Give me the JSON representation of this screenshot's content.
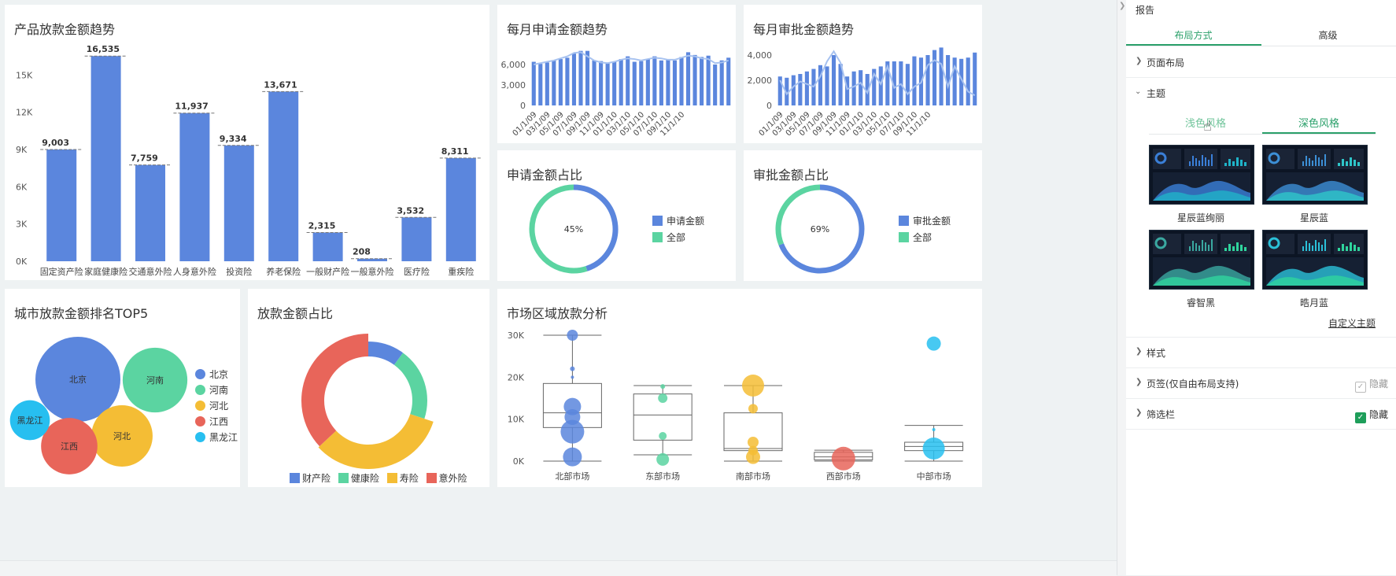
{
  "colors": {
    "blue": "#5b86dd",
    "green": "#5bd4a1",
    "yellow": "#f4bd35",
    "red": "#e8655a",
    "cyan": "#27bff0",
    "panel_accent": "#2aa06a"
  },
  "chart_data": [
    {
      "id": "product-loan",
      "type": "bar",
      "title": "产品放款金额趋势",
      "categories": [
        "固定资产险",
        "家庭健康险",
        "交通意外险",
        "人身意外险",
        "投资险",
        "养老保险",
        "一般财产险",
        "一般意外险",
        "医疗险",
        "重疾险"
      ],
      "values": [
        9003,
        16535,
        7759,
        11937,
        9334,
        13671,
        2315,
        208,
        3532,
        8311
      ],
      "value_labels": [
        "9,003",
        "16,535",
        "7,759",
        "11,937",
        "9,334",
        "13,671",
        "2,315",
        "208",
        "3,532",
        "8,311"
      ],
      "yticks": [
        "0K",
        "3K",
        "6K",
        "9K",
        "12K",
        "15K"
      ],
      "ylim": [
        0,
        17500
      ]
    },
    {
      "id": "monthly-apply",
      "type": "bar",
      "title": "每月申请金额趋势",
      "values": [
        6400,
        6100,
        6300,
        6600,
        6800,
        7000,
        7600,
        8000,
        8000,
        6600,
        6500,
        6300,
        6400,
        6800,
        7200,
        6400,
        6500,
        6800,
        7200,
        6600,
        6800,
        6600,
        7100,
        7800,
        7400,
        7100,
        7300,
        6000,
        6600,
        7000
      ],
      "line": [
        6000,
        6200,
        6400,
        6600,
        6900,
        7200,
        7700,
        7800,
        7200,
        6600,
        6300,
        6200,
        6400,
        6700,
        6900,
        6800,
        6600,
        6800,
        7000,
        6900,
        6700,
        6700,
        7000,
        7300,
        7200,
        6900,
        6800,
        6200,
        6300,
        6600
      ],
      "yticks": [
        "0",
        "3,000",
        "6,000"
      ],
      "ylim": [
        0,
        9000
      ],
      "xticks": [
        "01/1/09",
        "03/1/09",
        "05/1/09",
        "07/1/09",
        "09/1/09",
        "11/1/09",
        "01/1/10",
        "03/1/10",
        "05/1/10",
        "07/1/10",
        "09/1/10",
        "11/1/10"
      ]
    },
    {
      "id": "monthly-approve",
      "type": "bar",
      "title": "每月审批金额趋势",
      "values": [
        2300,
        2200,
        2400,
        2500,
        2700,
        2900,
        3200,
        3100,
        4000,
        3300,
        2300,
        2700,
        2800,
        2500,
        2900,
        3100,
        3500,
        3500,
        3500,
        3300,
        3900,
        3800,
        4000,
        4400,
        4600,
        4000,
        3800,
        3700,
        3800,
        4200
      ],
      "line": [
        2000,
        900,
        1500,
        1900,
        1700,
        1500,
        2300,
        3500,
        4300,
        3400,
        1300,
        1500,
        1800,
        1000,
        2500,
        1700,
        3100,
        1400,
        1700,
        900,
        1500,
        1800,
        3200,
        3600,
        3300,
        1500,
        3100,
        2100,
        1100,
        800
      ],
      "yticks": [
        "0",
        "2,000",
        "4,000"
      ],
      "ylim": [
        0,
        5000
      ],
      "xticks": [
        "01/1/09",
        "03/1/09",
        "05/1/09",
        "07/1/09",
        "09/1/09",
        "11/1/09",
        "01/1/10",
        "03/1/10",
        "05/1/10",
        "07/1/10",
        "09/1/10",
        "11/1/10"
      ]
    },
    {
      "id": "apply-ratio",
      "type": "pie",
      "title": "申请金额占比",
      "center_label": "45%",
      "slices": [
        {
          "name": "申请金额",
          "value": 45,
          "color": "#5b86dd"
        },
        {
          "name": "全部",
          "value": 55,
          "color": "#5bd4a1"
        }
      ]
    },
    {
      "id": "approve-ratio",
      "type": "pie",
      "title": "审批金额占比",
      "center_label": "69%",
      "slices": [
        {
          "name": "审批金额",
          "value": 69,
          "color": "#5b86dd"
        },
        {
          "name": "全部",
          "value": 31,
          "color": "#5bd4a1"
        }
      ]
    },
    {
      "id": "city-top5",
      "type": "scatter",
      "title": "城市放款金额排名TOP5",
      "bubbles": [
        {
          "name": "北京",
          "value": 100,
          "color": "#5b86dd"
        },
        {
          "name": "河南",
          "value": 58,
          "color": "#5bd4a1"
        },
        {
          "name": "河北",
          "value": 52,
          "color": "#f4bd35"
        },
        {
          "name": "江西",
          "value": 44,
          "color": "#e8655a"
        },
        {
          "name": "黑龙江",
          "value": 22,
          "color": "#27bff0"
        }
      ]
    },
    {
      "id": "loan-ratio",
      "type": "pie",
      "title": "放款金额占比",
      "slices": [
        {
          "name": "财产险",
          "value": 10,
          "color": "#5b86dd"
        },
        {
          "name": "健康险",
          "value": 20,
          "color": "#5bd4a1"
        },
        {
          "name": "寿险",
          "value": 33,
          "color": "#f4bd35"
        },
        {
          "name": "意外险",
          "value": 37,
          "color": "#e8655a"
        }
      ]
    },
    {
      "id": "market-region",
      "type": "scatter",
      "title": "市场区域放款分析",
      "yticks": [
        "0K",
        "10K",
        "20K",
        "30K"
      ],
      "ylim": [
        0,
        30000
      ],
      "categories": [
        "北部市场",
        "东部市场",
        "南部市场",
        "西部市场",
        "中部市场"
      ],
      "boxes": [
        {
          "min": 0,
          "q1": 8000,
          "median": 11500,
          "q3": 18500,
          "max": 30000,
          "color": "#5b86dd",
          "points": [
            [
              30000,
              14
            ],
            [
              22000,
              6
            ],
            [
              20000,
              4
            ],
            [
              13000,
              22
            ],
            [
              10500,
              20
            ],
            [
              7000,
              30
            ],
            [
              1000,
              24
            ]
          ]
        },
        {
          "min": 1500,
          "q1": 5000,
          "median": 11000,
          "q3": 16000,
          "max": 18000,
          "color": "#5bd4a1",
          "points": [
            [
              17800,
              6
            ],
            [
              15000,
              12
            ],
            [
              6000,
              10
            ],
            [
              400,
              16
            ]
          ]
        },
        {
          "min": 0,
          "q1": 2500,
          "median": 3000,
          "q3": 11500,
          "max": 18000,
          "color": "#f4bd35",
          "points": [
            [
              18000,
              28
            ],
            [
              12500,
              12
            ],
            [
              4500,
              14
            ],
            [
              2500,
              12
            ],
            [
              1000,
              18
            ]
          ]
        },
        {
          "min": 0,
          "q1": 300,
          "median": 1000,
          "q3": 2100,
          "max": 2600,
          "color": "#e8655a",
          "points": [
            [
              600,
              30
            ]
          ]
        },
        {
          "min": 0,
          "q1": 2500,
          "median": 3500,
          "q3": 4500,
          "max": 8500,
          "color": "#27bff0",
          "points": [
            [
              28000,
              18
            ],
            [
              7500,
              4
            ],
            [
              3000,
              28
            ]
          ]
        }
      ]
    }
  ],
  "panel": {
    "title": "报告",
    "tabs": [
      "布局方式",
      "高级"
    ],
    "sections": {
      "page_layout": "页面布局",
      "theme": "主题",
      "style": "样式",
      "page_tab": "页签(仅自由布局支持)",
      "filter_bar": "筛选栏"
    },
    "theme_tabs": [
      "浅色风格",
      "深色风格"
    ],
    "themes": [
      "星辰蓝绚丽",
      "星辰蓝",
      "睿智黑",
      "晧月蓝"
    ],
    "custom_theme": "自定义主题",
    "hide_label": "隐藏",
    "filter_hide_label": "隐藏"
  }
}
